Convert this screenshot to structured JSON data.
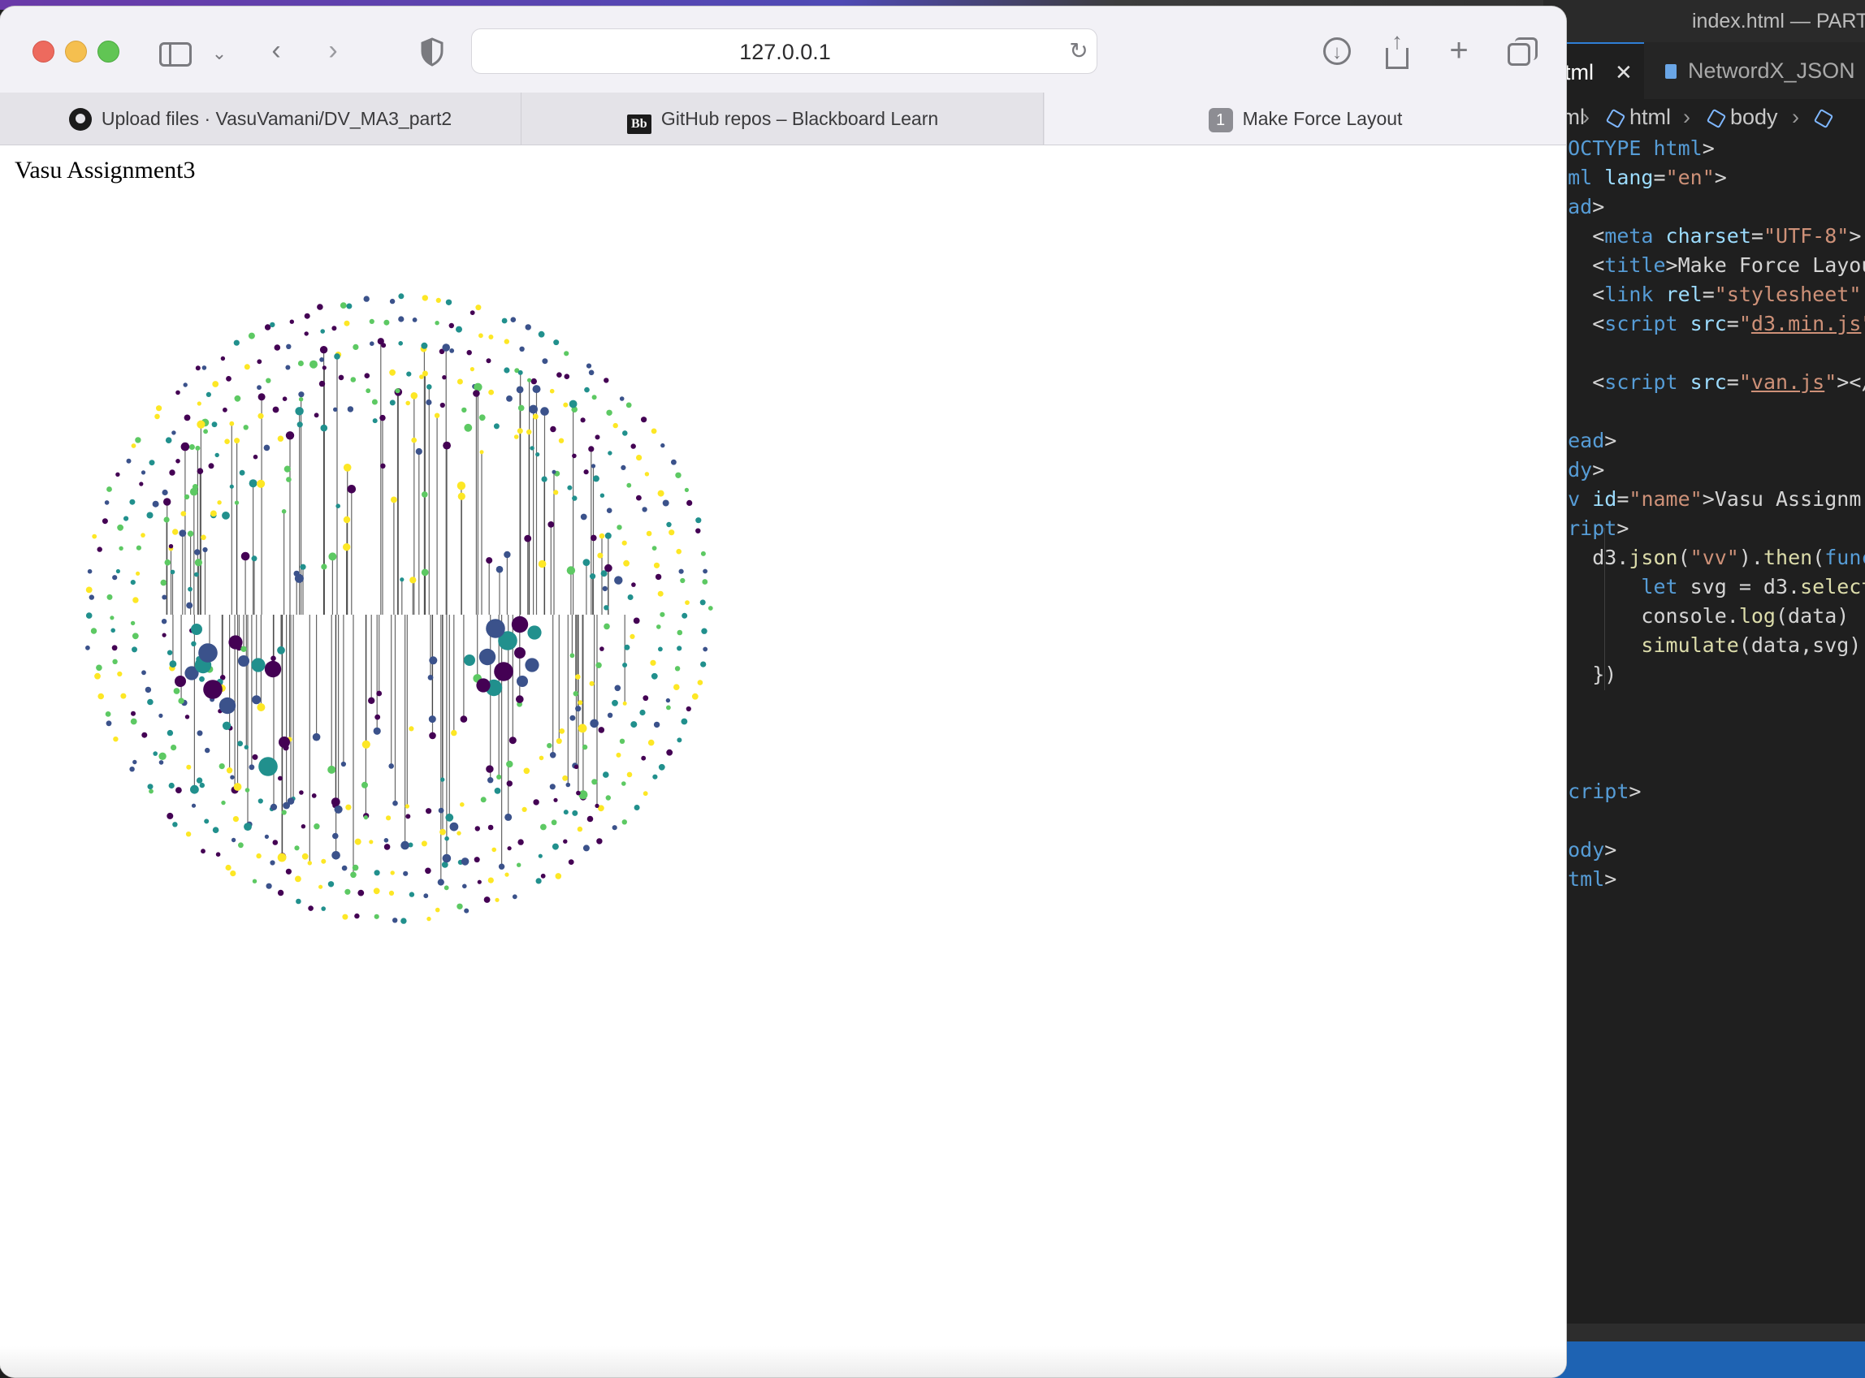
{
  "editor": {
    "window_title": "index.html — PART",
    "tabs": [
      {
        "label": "tml",
        "close": "✕"
      },
      {
        "label": "NetwordX_JSON"
      }
    ],
    "breadcrumb": [
      "html",
      "html",
      "body"
    ],
    "code_lines": [
      "!DOCTYPE html>",
      "html lang=\"en\">",
      "head>",
      "    <meta charset=\"UTF-8\">",
      "    <title>Make Force Layou",
      "    <link rel=\"stylesheet\"",
      "    <script src=\"d3.min.js\"",
      "",
      "    <script src=\"van.js\"></",
      "",
      "/head>",
      "body>",
      "div id=\"name\">Vasu Assignm",
      "script>",
      "    d3.json(\"vv\").then(func",
      "        let svg = d3.select",
      "        console.log(data)",
      "        simulate(data,svg)",
      "    })",
      "",
      "",
      "",
      "/script>",
      "",
      "/body>",
      "/html>"
    ]
  },
  "browser": {
    "url": "127.0.0.1",
    "tabs": [
      {
        "label": "Upload files · VasuVamani/DV_MA3_part2",
        "icon": "github-icon"
      },
      {
        "label": "GitHub repos – Blackboard Learn",
        "icon": "blackboard-icon",
        "icon_text": "Bb"
      },
      {
        "label": "Make Force Layout",
        "icon": "tab-number-icon",
        "icon_text": "1"
      }
    ],
    "page_heading": "Vasu Assignment3",
    "palette": [
      "#440154",
      "#3b528b",
      "#21908d",
      "#5dc963",
      "#fde725"
    ]
  }
}
